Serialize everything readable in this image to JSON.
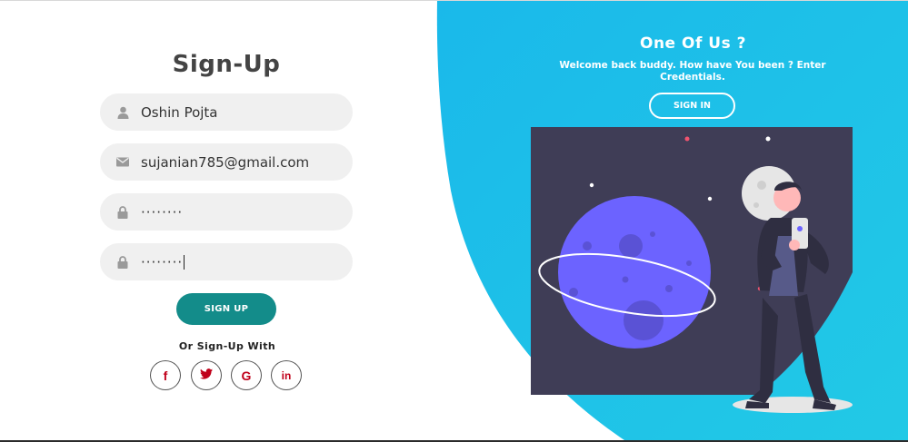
{
  "signup": {
    "title": "Sign-Up",
    "name_value": "Oshin Pojta",
    "email_value": "sujanian785@gmail.com",
    "password_value": "········",
    "confirm_password_value": "········",
    "button_label": "SIGN UP",
    "or_text": "Or Sign-Up With",
    "social": [
      {
        "icon": "facebook-icon",
        "glyph": "f"
      },
      {
        "icon": "twitter-icon",
        "glyph": ""
      },
      {
        "icon": "google-icon",
        "glyph": "G"
      },
      {
        "icon": "linkedin-icon",
        "glyph": "in"
      }
    ]
  },
  "panel": {
    "title": "One Of Us ?",
    "subtitle": "Welcome back buddy. How have You been ? Enter Credentials.",
    "signin_label": "SIGN IN"
  },
  "colors": {
    "accent_teal": "#138c8a",
    "panel_blue": "#1bbfe9",
    "social_red": "#c0001a",
    "field_bg": "#f0f0f0"
  }
}
